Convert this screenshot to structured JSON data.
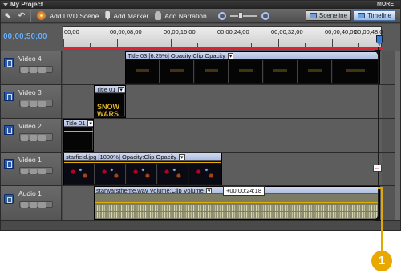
{
  "panel": {
    "title": "My Project",
    "more_label": "MORE"
  },
  "toolbar": {
    "add_dvd_scene": "Add DVD Scene",
    "add_marker": "Add Marker",
    "add_narration": "Add Narration",
    "sceneline": "Sceneline",
    "timeline": "Timeline"
  },
  "timecode": "00;00;50;00",
  "ruler": {
    "ticks": [
      "00;00",
      "00;00;08;00",
      "00;00;16;00",
      "00;00;24;00",
      "00;00;32;00",
      "00;00;40;00",
      "00;00;48;0"
    ]
  },
  "tracks": [
    {
      "label": "Video 4"
    },
    {
      "label": "Video 3"
    },
    {
      "label": "Video 2"
    },
    {
      "label": "Video 1"
    },
    {
      "label": "Audio 1"
    }
  ],
  "clips": {
    "v4_title": "Title 03 [6.25%]  Opacity:Clip Opacity",
    "v3_title": "Title 01",
    "v3_text1": "SNOW",
    "v3_text2": "WARS",
    "v2_title": "Title 01",
    "v1_title": "starfield.jpg [1000%]  Opacity:Clip Opacity",
    "a1_title": "starwarstheme.wav  Volume:Clip Volume",
    "a1_tooltip": "+00;00;24;18"
  },
  "callout_number": "1",
  "colors": {
    "timecode": "#6fb4ff",
    "callout": "#e8a800",
    "clip_header": "#aebde0"
  }
}
